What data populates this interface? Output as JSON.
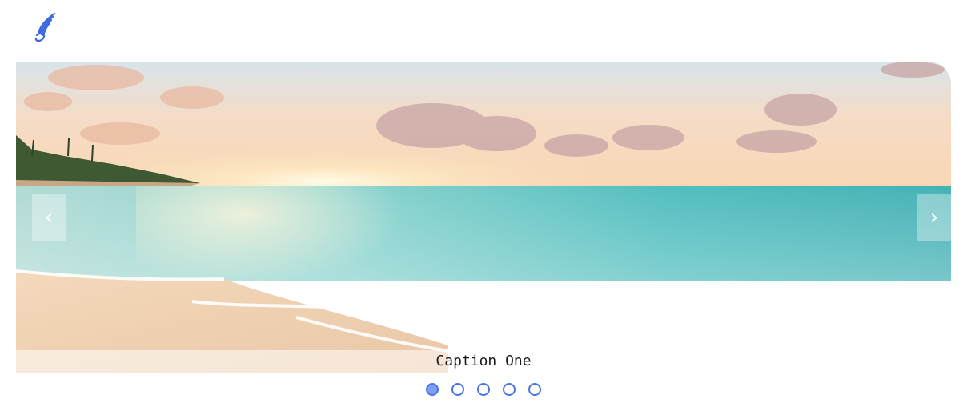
{
  "brand": {
    "logo_icon": "winged-swirl-logo-icon",
    "logo_color": "#3b68e0"
  },
  "carousel": {
    "prev_label": "‹",
    "next_label": "›",
    "caption": "Caption One",
    "slide_image": "beach-sunset-ocean-photo",
    "slides_count": 5,
    "active_index": 0,
    "dot_color": "#4a73e8",
    "dot_active_fill": "#7f9ef2"
  }
}
